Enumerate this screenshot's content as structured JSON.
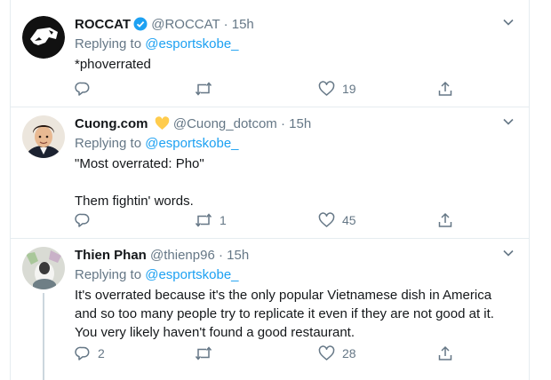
{
  "tweets": [
    {
      "name": "ROCCAT",
      "badge": "verified",
      "handle": "@ROCCAT",
      "dot": "·",
      "time": "15h",
      "replying_prefix": "Replying to",
      "replying_to": "@esportskobe_",
      "text": "*phoverrated",
      "reply_count": "",
      "retweet_count": "",
      "like_count": "19"
    },
    {
      "name": "Cuong.com",
      "badge": "yellow-heart",
      "handle": "@Cuong_dotcom",
      "dot": "·",
      "time": "15h",
      "replying_prefix": "Replying to",
      "replying_to": "@esportskobe_",
      "text": "\"Most overrated: Pho\"\n\nThem fightin' words.",
      "reply_count": "",
      "retweet_count": "1",
      "like_count": "45"
    },
    {
      "name": "Thien Phan",
      "badge": "",
      "handle": "@thienp96",
      "dot": "·",
      "time": "15h",
      "replying_prefix": "Replying to",
      "replying_to": "@esportskobe_",
      "text": "It's overrated because it's the only popular Vietnamese dish in America and so too many people try to replicate it even if they are not good at it. You very likely haven't found a good restaurant.",
      "reply_count": "2",
      "retweet_count": "",
      "like_count": "28"
    }
  ],
  "colors": {
    "text": "#14171a",
    "muted": "#657786",
    "link": "#1da1f2",
    "border": "#e6ecf0",
    "heart_badge": "#ffcc4d"
  },
  "icons": [
    "reply-icon",
    "retweet-icon",
    "like-icon",
    "share-icon",
    "chevron-down-icon",
    "verified-icon",
    "yellow-heart-icon"
  ]
}
